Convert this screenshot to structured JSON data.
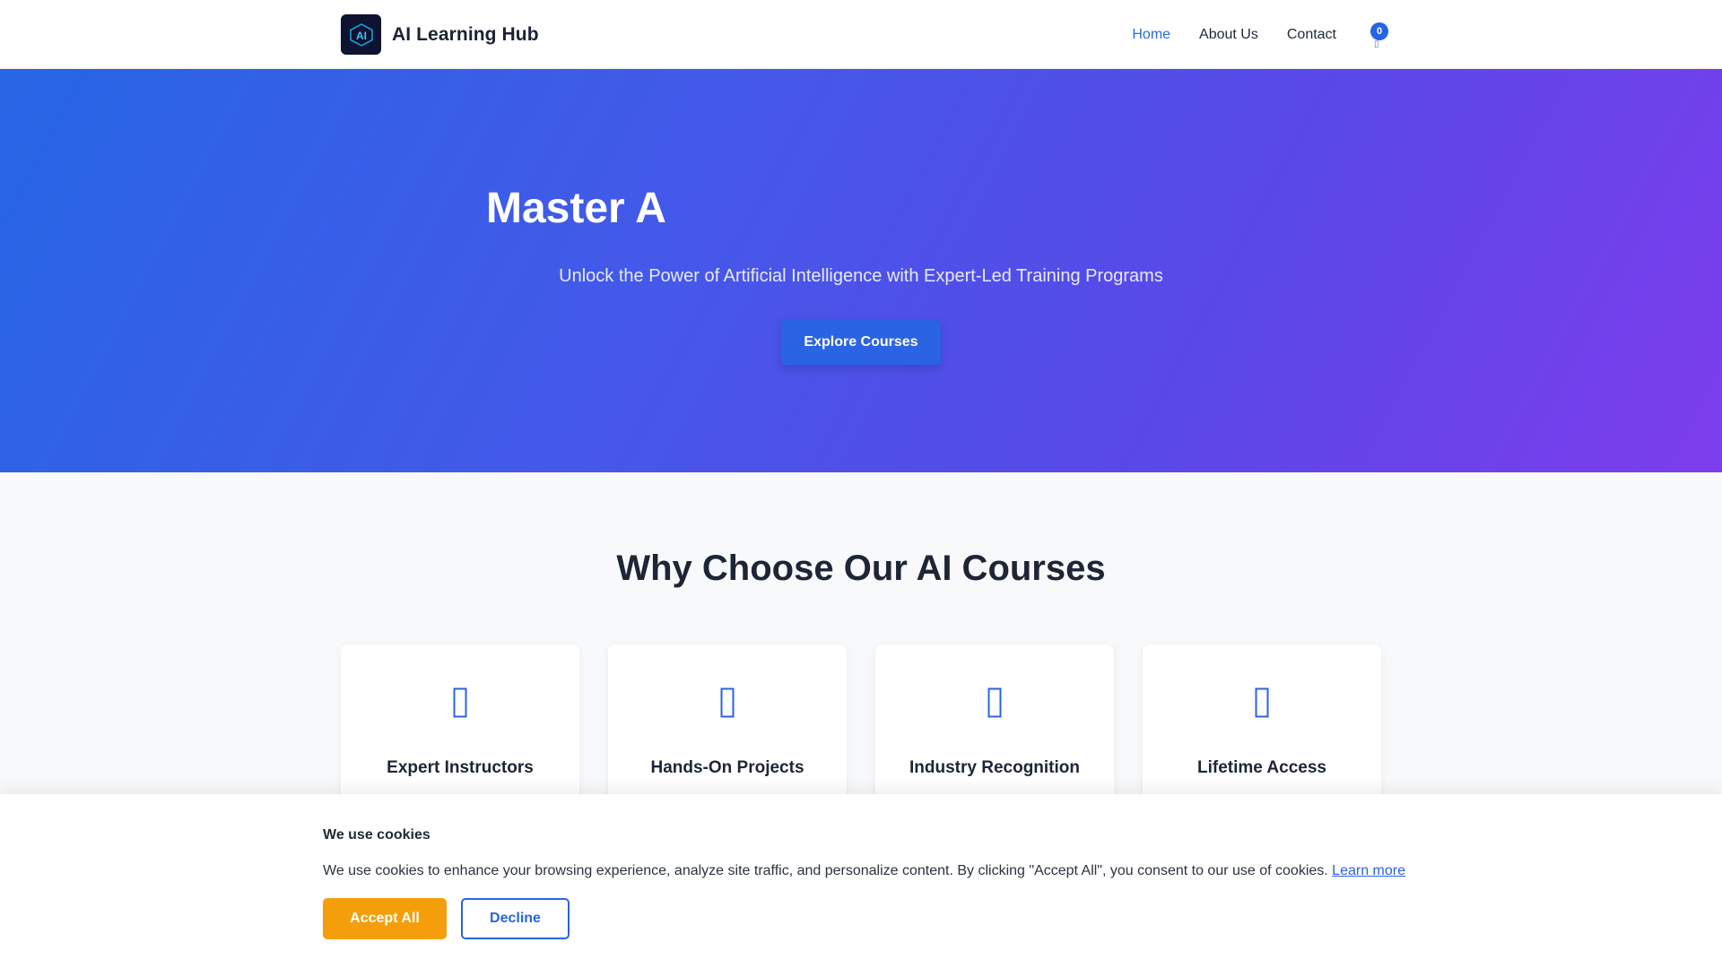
{
  "header": {
    "logo_text": "AI",
    "brand": "AI Learning Hub",
    "nav": [
      {
        "label": "Home",
        "active": true
      },
      {
        "label": "About Us",
        "active": false
      },
      {
        "label": "Contact",
        "active": false
      }
    ],
    "cart_count": "0"
  },
  "hero": {
    "title": "Master A",
    "subtitle": "Unlock the Power of Artificial Intelligence with Expert-Led Training Programs",
    "cta_label": "Explore Courses"
  },
  "features": {
    "title": "Why Choose Our AI Courses",
    "cards": [
      {
        "title": "Expert Instructors",
        "icon": "instructor-icon"
      },
      {
        "title": "Hands-On Projects",
        "icon": "projects-icon"
      },
      {
        "title": "Industry Recognition",
        "icon": "recognition-icon"
      },
      {
        "title": "Lifetime Access",
        "icon": "access-icon"
      }
    ]
  },
  "cookie": {
    "title": "We use cookies",
    "text": "We use cookies to enhance your browsing experience, analyze site traffic, and personalize content. By clicking \"Accept All\", you consent to our use of cookies.",
    "link": "Learn more",
    "accept_label": "Accept All",
    "decline_label": "Decline"
  },
  "colors": {
    "accent": "#2a63e3",
    "accept": "#f59e0b",
    "hero_start": "#2766e6",
    "hero_end": "#7d3ded"
  }
}
